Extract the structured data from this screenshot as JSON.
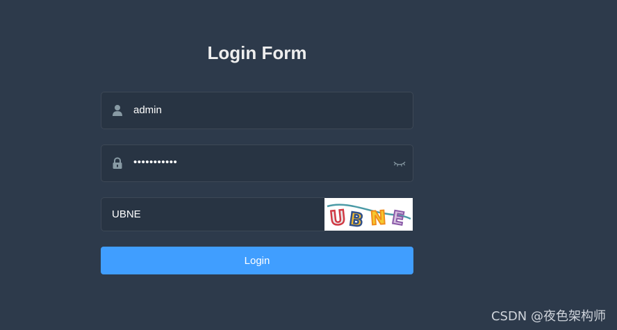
{
  "form": {
    "title": "Login Form",
    "username": {
      "value": "admin",
      "icon": "user-icon"
    },
    "password": {
      "value": "•••••••••••",
      "icon": "lock-icon",
      "toggle_icon": "eye-closed-icon"
    },
    "captcha": {
      "value": "UBNE",
      "image_text": "UBNE"
    },
    "login_label": "Login"
  },
  "watermark": "CSDN @夜色架构师",
  "colors": {
    "background": "#2d3a4b",
    "field_background": "#283443",
    "primary_button": "#409eff",
    "icon": "#889aa4"
  }
}
